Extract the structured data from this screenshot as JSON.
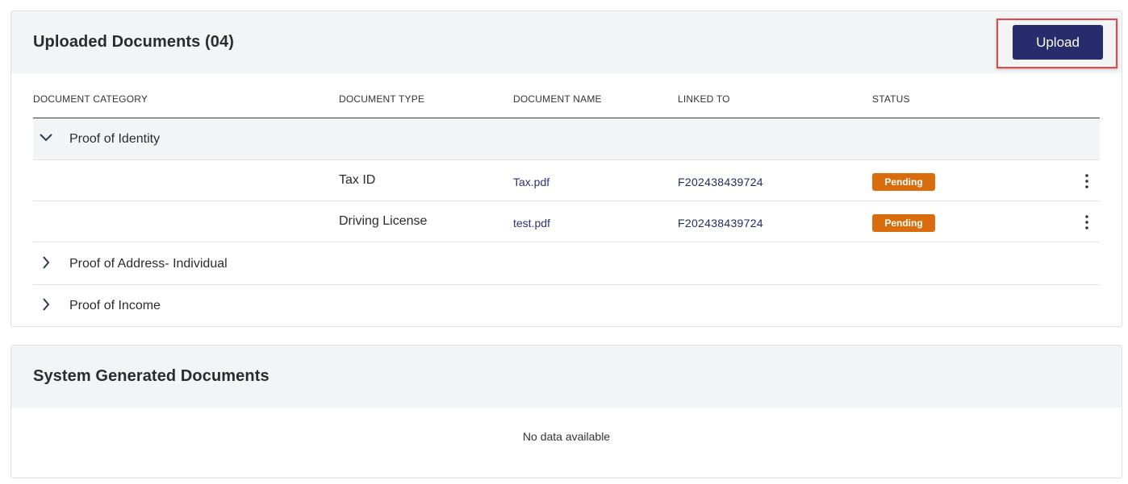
{
  "uploaded": {
    "title": "Uploaded Documents (04)",
    "upload_label": "Upload",
    "columns": {
      "category": "DOCUMENT CATEGORY",
      "type": "DOCUMENT TYPE",
      "name": "DOCUMENT NAME",
      "linked": "LINKED TO",
      "status": "STATUS"
    },
    "groups": [
      {
        "label": "Proof of Identity",
        "expanded": true,
        "documents": [
          {
            "type": "Tax ID",
            "name": "Tax.pdf",
            "linked": "F202438439724",
            "status": "Pending"
          },
          {
            "type": "Driving License",
            "name": "test.pdf",
            "linked": "F202438439724",
            "status": "Pending"
          }
        ]
      },
      {
        "label": "Proof of Address- Individual",
        "expanded": false
      },
      {
        "label": "Proof of Income",
        "expanded": false
      }
    ]
  },
  "system": {
    "title": "System Generated Documents",
    "empty_text": "No data available"
  },
  "icons": {
    "expanded": "chevron-down-icon",
    "collapsed": "chevron-right-icon",
    "row_menu": "more-vertical-icon"
  },
  "colors": {
    "primary_button": "#262c6c",
    "pending_badge": "#d96d0e",
    "highlight_border": "#e0484a",
    "header_background": "#f2f4f6"
  }
}
